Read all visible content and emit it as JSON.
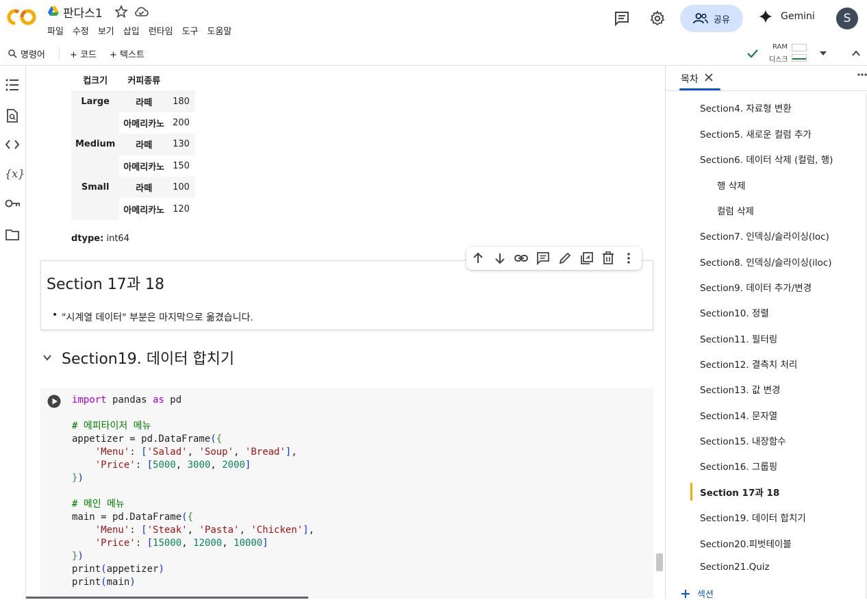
{
  "header": {
    "title": "판다스1",
    "menu": [
      "파일",
      "수정",
      "보기",
      "삽입",
      "런타임",
      "도구",
      "도움말"
    ],
    "share_label": "공유",
    "gemini_label": "Gemini",
    "avatar_letter": "S"
  },
  "toolbar": {
    "command_label": "명령어",
    "add_code_label": "+ 코드",
    "add_text_label": "+ 텍스트",
    "ram_label": "RAM",
    "disk_label": "디스크"
  },
  "dataframe": {
    "headers": [
      "컵크기",
      "커피종류"
    ],
    "rows": [
      {
        "index": "Large",
        "sub": "라떼",
        "value": "180"
      },
      {
        "index": "",
        "sub": "아메리카노",
        "value": "200"
      },
      {
        "index": "Medium",
        "sub": "라떼",
        "value": "130"
      },
      {
        "index": "",
        "sub": "아메리카노",
        "value": "150"
      },
      {
        "index": "Small",
        "sub": "라떼",
        "value": "100"
      },
      {
        "index": "",
        "sub": "아메리카노",
        "value": "120"
      }
    ],
    "dtype_label": "dtype:",
    "dtype_value": "int64"
  },
  "text_cell": {
    "heading": "Section 17과 18",
    "bullet": "\"시계열 데이터\" 부분은 마지막으로 옮겼습니다."
  },
  "section_header": "Section19. 데이터 합치기",
  "code_lines": [
    {
      "text": "import pandas as pd"
    },
    {
      "text": ""
    },
    {
      "text": "# 에피타이저 메뉴"
    },
    {
      "text": "appetizer = pd.DataFrame({"
    },
    {
      "text": "    'Menu': ['Salad', 'Soup', 'Bread'],"
    },
    {
      "text": "    'Price': [5000, 3000, 2000]"
    },
    {
      "text": "})"
    },
    {
      "text": ""
    },
    {
      "text": "# 메인 메뉴"
    },
    {
      "text": "main = pd.DataFrame({"
    },
    {
      "text": "    'Menu': ['Steak', 'Pasta', 'Chicken'],"
    },
    {
      "text": "    'Price': [15000, 12000, 10000]"
    },
    {
      "text": "})"
    },
    {
      "text": "print(appetizer)"
    },
    {
      "text": "print(main)"
    }
  ],
  "toc": {
    "tab_label": "목차",
    "add_section_label": "섹션",
    "items": [
      {
        "label": "Section4. 자료형 변환",
        "level": 1
      },
      {
        "label": "Section5. 새로운 컬럼 추가",
        "level": 1
      },
      {
        "label": "Section6. 데이터 삭제 (컬럼, 행)",
        "level": 1
      },
      {
        "label": "행 삭제",
        "level": 2
      },
      {
        "label": "컬럼 삭제",
        "level": 2
      },
      {
        "label": "Section7. 인덱싱/슬라이싱(loc)",
        "level": 1
      },
      {
        "label": "Section8. 인덱싱/슬라이싱(iloc)",
        "level": 1
      },
      {
        "label": "Section9. 데이터 추가/변경",
        "level": 1
      },
      {
        "label": "Section10. 정렬",
        "level": 1
      },
      {
        "label": "Section11. 필터링",
        "level": 1
      },
      {
        "label": "Section12. 결측치 처리",
        "level": 1
      },
      {
        "label": "Section13. 값 변경",
        "level": 1
      },
      {
        "label": "Section14. 문자열",
        "level": 1
      },
      {
        "label": "Section15. 내장함수",
        "level": 1
      },
      {
        "label": "Section16. 그룹핑",
        "level": 1
      },
      {
        "label": "Section 17과 18",
        "level": 1,
        "active": true
      },
      {
        "label": "Section19. 데이터 합치기",
        "level": 1
      },
      {
        "label": "Section20.피벗테이블",
        "level": 1
      },
      {
        "label": "Section21.Quiz",
        "level": 1
      }
    ]
  },
  "colors": {
    "accent": "#0b57d0",
    "share_bg": "#d3e3fd",
    "toc_marker": "#f9ab00",
    "runtime_ok": "#188038"
  }
}
